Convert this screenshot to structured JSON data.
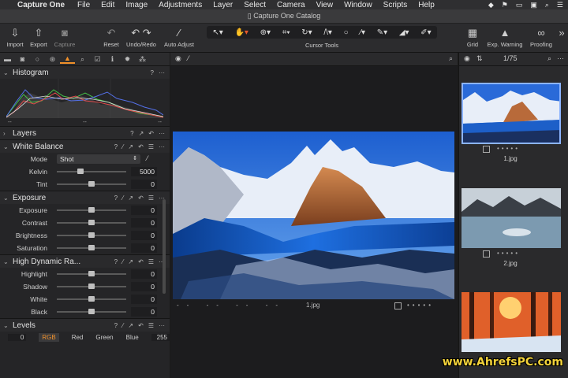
{
  "menubar": {
    "app": "Capture One",
    "items": [
      "File",
      "Edit",
      "Image",
      "Adjustments",
      "Layer",
      "Select",
      "Camera",
      "View",
      "Window",
      "Scripts",
      "Help"
    ]
  },
  "window_title": "Capture One Catalog",
  "toolbar": {
    "import": "Import",
    "export": "Export",
    "capture": "Capture",
    "reset": "Reset",
    "undo_redo": "Undo/Redo",
    "auto_adjust": "Auto Adjust",
    "cursor_tools": "Cursor Tools",
    "grid": "Grid",
    "exp_warning": "Exp. Warning",
    "proofing": "Proofing"
  },
  "histogram": {
    "title": "Histogram",
    "footer": [
      "--",
      "--",
      "--"
    ]
  },
  "layers": {
    "title": "Layers"
  },
  "white_balance": {
    "title": "White Balance",
    "mode_label": "Mode",
    "mode_value": "Shot",
    "kelvin_label": "Kelvin",
    "kelvin_value": "5000",
    "tint_label": "Tint",
    "tint_value": "0"
  },
  "exposure": {
    "title": "Exposure",
    "rows": [
      {
        "label": "Exposure",
        "value": "0"
      },
      {
        "label": "Contrast",
        "value": "0"
      },
      {
        "label": "Brightness",
        "value": "0"
      },
      {
        "label": "Saturation",
        "value": "0"
      }
    ]
  },
  "hdr": {
    "title": "High Dynamic Ra...",
    "rows": [
      {
        "label": "Highlight",
        "value": "0"
      },
      {
        "label": "Shadow",
        "value": "0"
      },
      {
        "label": "White",
        "value": "0"
      },
      {
        "label": "Black",
        "value": "0"
      }
    ]
  },
  "levels": {
    "title": "Levels",
    "low": "0",
    "channels": [
      "RGB",
      "Red",
      "Green",
      "Blue"
    ],
    "high": "255"
  },
  "viewer": {
    "filename": "1.jpg",
    "info": [
      "--",
      "--",
      "--",
      "--"
    ]
  },
  "browser": {
    "count": "1/75",
    "thumbs": [
      {
        "name": "1.jpg"
      },
      {
        "name": "2.jpg"
      }
    ]
  },
  "watermark": "www.AhrefsPC.com",
  "colors": {
    "accent": "#f0902a",
    "panel": "#252527",
    "background": "#1b1b1b"
  }
}
